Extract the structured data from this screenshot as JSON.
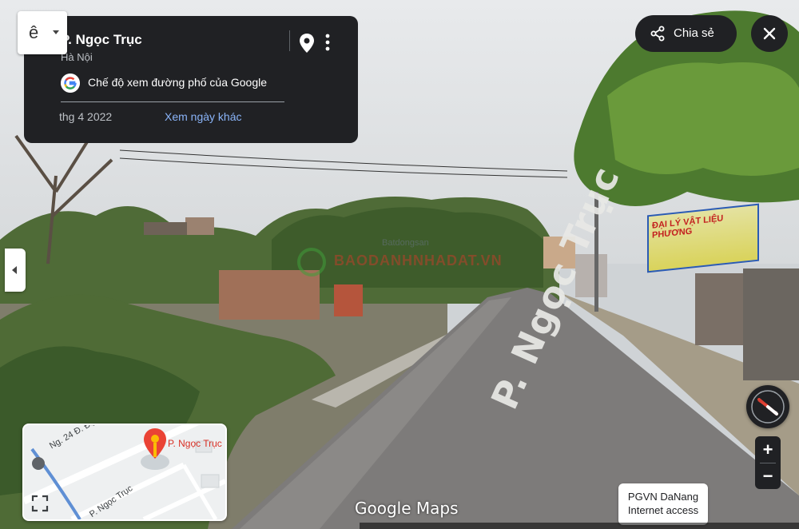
{
  "language_button": {
    "glyph": "ê"
  },
  "location_card": {
    "street_name": "P. Ngọc Trục",
    "city": "Hà Nội",
    "street_view_label": "Chế độ xem đường phố của Google",
    "date": "thg 4 2022",
    "see_other_dates": "Xem ngày khác"
  },
  "share": {
    "label": "Chia sẻ"
  },
  "road_marking": "P. Ngọc Trục",
  "shop_sign": "ĐẠI LÝ VẬT LIỆU PHƯƠNG",
  "watermark": {
    "brand": "Batdongsan",
    "line": "BAODANHNHADAT.VN"
  },
  "minimap": {
    "place_label": "P. Ngọc Trục",
    "road_label_1": "Ng. 24 Đ. Đại",
    "road_label_2": "P. Ngọc Trục"
  },
  "zoom": {
    "in": "+",
    "out": "−"
  },
  "footer": {
    "google_maps_logo": "Google Maps",
    "pgvn_line1": "PGVN DaNang",
    "pgvn_line2": "Internet access"
  },
  "colors": {
    "card_bg": "#202124",
    "link_blue": "#8ab4f8",
    "pin_red": "#ea4335",
    "pin_yellow": "#fbbc04"
  },
  "icons": [
    "map-pin-icon",
    "more-vert-icon",
    "google-g-icon",
    "share-icon",
    "close-icon",
    "chevron-left-icon",
    "expand-icon",
    "compass-icon"
  ]
}
